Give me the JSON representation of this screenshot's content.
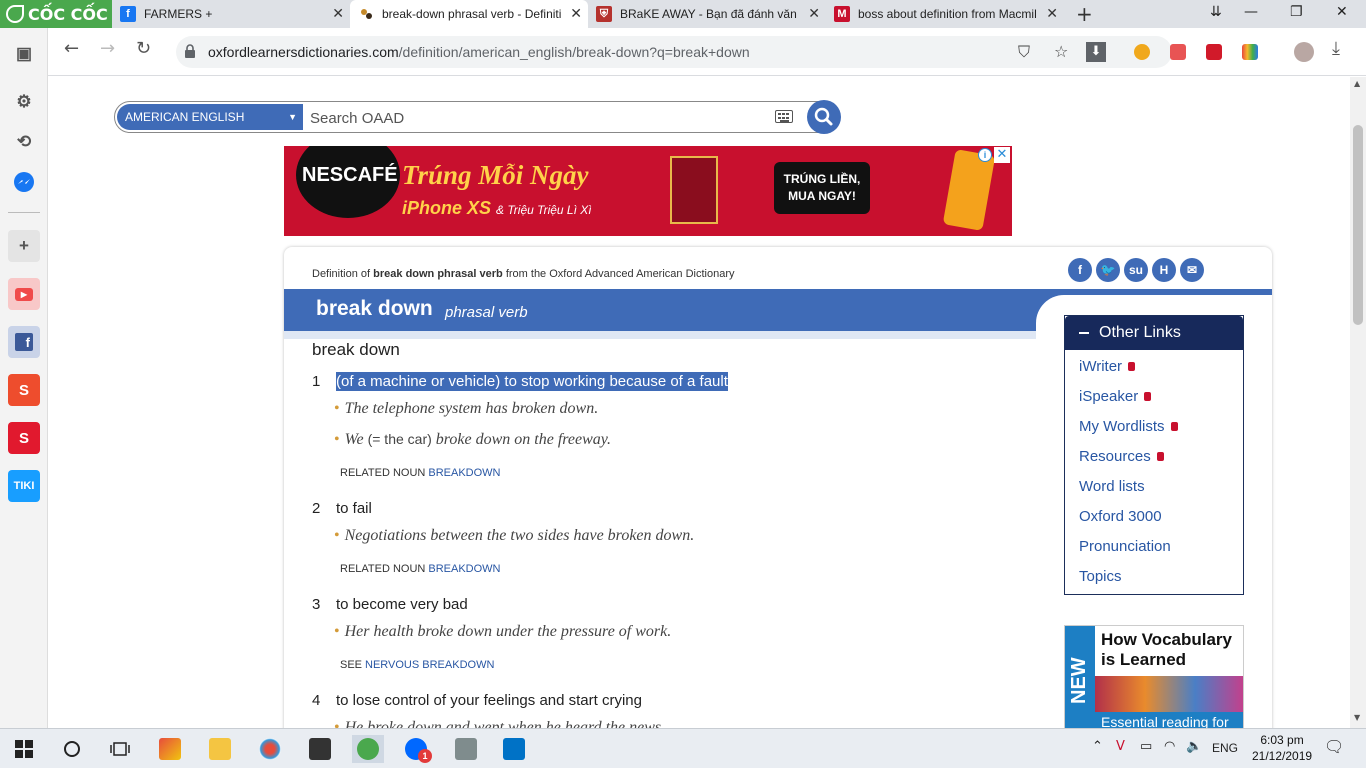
{
  "browser": {
    "brand": "CỐC CỐC",
    "tabs": [
      {
        "title": "FARMERS +",
        "favicon": "facebook-icon",
        "color": "#1877f2"
      },
      {
        "title": "break-down phrasal verb - Definiti",
        "favicon": "oxford-icon",
        "color": "#7b4b2a"
      },
      {
        "title": "BRaKE AWAY - Bạn đã đánh văn d",
        "favicon": "shield-crest-icon",
        "color": "#b5322e"
      },
      {
        "title": "boss about definition from Macmil",
        "favicon": "macmillan-icon",
        "color": "#c8102e"
      }
    ],
    "url_host": "oxfordlearnersdictionaries.com",
    "url_path": "/definition/american_english/break-down?q=break+down"
  },
  "sidebar": {
    "items": [
      {
        "name": "settings-icon",
        "glyph": "⚙"
      },
      {
        "name": "history-icon",
        "glyph": "⟲"
      },
      {
        "name": "messenger-icon",
        "glyph": "✉",
        "color": "#1877f2"
      },
      {
        "name": "add-icon",
        "glyph": "+"
      },
      {
        "name": "youtube-icon",
        "glyph": "▶",
        "color": "#f04a4a"
      },
      {
        "name": "facebook-icon",
        "glyph": "f",
        "color": "#3b5998"
      },
      {
        "name": "shopee-icon",
        "glyph": "S",
        "color": "#ee4d2d"
      },
      {
        "name": "sendo-icon",
        "glyph": "S",
        "color": "#e1192e"
      },
      {
        "name": "tiki-icon",
        "glyph": "TIKI",
        "color": "#189eff"
      }
    ]
  },
  "search": {
    "dictionary": "AMERICAN ENGLISH",
    "placeholder": "Search OAAD"
  },
  "ad": {
    "brand": "NESCAFÉ",
    "headline": "Trúng Mỗi Ngày",
    "sub": "iPhone XS",
    "sub_small": "& Triệu Triệu Lì Xì",
    "cta_line1": "TRÚNG LIỀN,",
    "cta_line2": "MUA NGAY!"
  },
  "entry": {
    "source_prefix": "Definition of",
    "source_term": "break down phrasal verb",
    "source_suffix": "from the Oxford Advanced American Dictionary",
    "headword": "break down",
    "pos": "phrasal verb",
    "phrase": "break down",
    "senses": [
      {
        "num": "1",
        "def": "(of a machine or vehicle) to stop working because of a fault",
        "examples": [
          "The telephone system has broken down."
        ],
        "example2_a": "We",
        "example2_gloss": "(= the car)",
        "example2_b": "broke down on the freeway.",
        "xref_label": "RELATED NOUN",
        "xref_link": "BREAKDOWN"
      },
      {
        "num": "2",
        "def": "to fail",
        "examples": [
          "Negotiations between the two sides have broken down."
        ],
        "xref_label": "RELATED NOUN",
        "xref_link": "BREAKDOWN"
      },
      {
        "num": "3",
        "def": "to become very bad",
        "examples": [
          "Her health broke down under the pressure of work."
        ],
        "xref_label": "SEE",
        "xref_link": "NERVOUS BREAKDOWN"
      },
      {
        "num": "4",
        "def": "to lose control of your feelings and start crying",
        "examples": [
          "He broke down and wept when he heard the news."
        ]
      }
    ]
  },
  "other_links": {
    "title": "Other Links",
    "items": [
      "iWriter",
      "iSpeaker",
      "My Wordlists",
      "Resources",
      "Word lists",
      "Oxford 3000",
      "Pronunciation",
      "Topics"
    ]
  },
  "promo": {
    "badge": "NEW",
    "title_line1": "How Vocabulary",
    "title_line2": "is Learned",
    "footer": "Essential reading for"
  },
  "taskbar": {
    "time": "6:03 pm",
    "date": "21/12/2019",
    "lang": "ENG",
    "badge": "1"
  },
  "colors": {
    "oxford_blue": "#3f6bb7",
    "navy": "#17295b",
    "link": "#2856a3",
    "bullet": "#d49b39"
  }
}
